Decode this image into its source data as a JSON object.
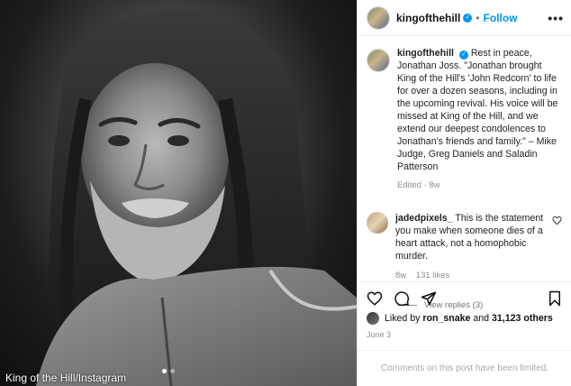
{
  "photo": {
    "credit": "King of the Hill/Instagram"
  },
  "header": {
    "username": "kingofthehill",
    "separator": "•",
    "follow_label": "Follow",
    "more_label": "•••"
  },
  "caption": {
    "username": "kingofthehill",
    "text": "Rest in peace, Jonathan Joss. \"Jonathan brought King of the Hill's 'John Redcorn' to life for over a dozen seasons, including in the upcoming revival. His voice will be missed at King of the Hill, and we extend our deepest condolences to Jonathan's friends and family.\" – Mike Judge, Greg Daniels and Saladin Patterson",
    "meta": "Edited · 8w"
  },
  "comment": {
    "username": "jadedpixels_",
    "text": "This is the statement you make when someone dies of a heart attack, not a homophobic murder.",
    "age": "8w",
    "likes": "131 likes"
  },
  "replies": {
    "label": "View replies (3)"
  },
  "likes_line": {
    "prefix": "Liked by",
    "user": "ron_snake",
    "middle": "and",
    "count": "31,123 others"
  },
  "post_date": "June 3",
  "comments_limited": "Comments on this post have been limited.",
  "colors": {
    "accent": "#0095f6",
    "muted": "#8e8e8e"
  },
  "icons": [
    "more-icon",
    "verified-icon",
    "heart-icon",
    "comment-icon",
    "share-icon",
    "save-icon"
  ]
}
